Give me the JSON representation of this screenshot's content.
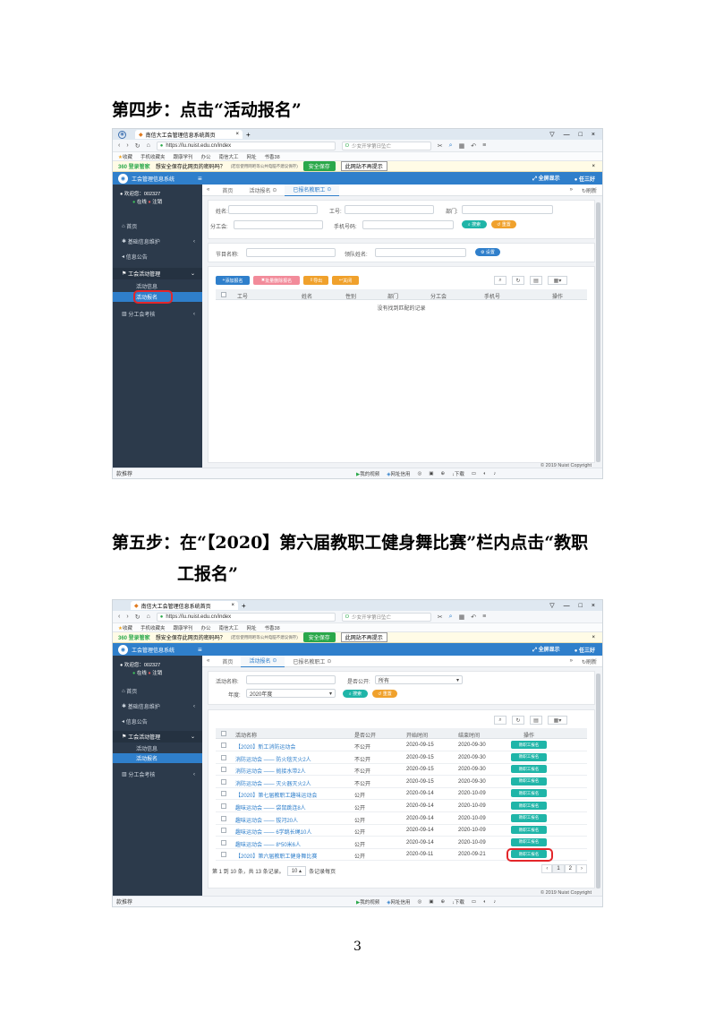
{
  "step4": {
    "heading": "第四步：点击“活动报名”"
  },
  "step5": {
    "heading_line1": "第五步：在“【2020】第六届教职工健身舞比赛”栏内点击“教职",
    "heading_line2": "工报名”"
  },
  "page_number": "3",
  "browser": {
    "tab_title": "南信大工会管理信息系统首页",
    "url": "https://lu.nuist.edu.cn/index",
    "search_placeholder": "少女开学第日坠亡",
    "favorites": [
      "收藏",
      "手机收藏夹",
      "跟康学刊",
      "办公",
      "南信大工",
      "网址",
      "书香38"
    ],
    "notice_brand": "360 登录管家",
    "notice_text": "想安全保存此网页的密码吗？",
    "notice_sub": "(若您使用网吧等公共电脑不建议保存)",
    "notice_save": "安全保存",
    "notice_dismiss": "此网站不再提示",
    "status_left": "款推荐",
    "status_items": [
      "我的视频",
      "网址信用",
      "下载"
    ]
  },
  "app": {
    "title": "工会管理信息系统",
    "menu_icon": "hamburger-icon",
    "fullscreen": "全屏显示",
    "user_name": "任三好",
    "welcome": "欢迎您：",
    "user_id": "002327",
    "online": "在线",
    "logout": "注销",
    "sidebar": {
      "home": "首页",
      "basic_info": "基础信息维护",
      "notice": "信息公告",
      "activity_mgmt": "工会活动管理",
      "activity_info": "活动信息",
      "activity_signup": "活动报名",
      "branch_eval": "分工会考核"
    },
    "refresh": "刷新",
    "copyright": "© 2019 Nuist Copyright"
  },
  "screen1": {
    "tabs": [
      "首页",
      "活动报名",
      "已报名教职工"
    ],
    "filters": {
      "name": "姓名:",
      "job_no": "工号:",
      "dept": "部门:",
      "branch": "分工会:",
      "phone": "手机号码:",
      "search": "搜索",
      "reset": "重置",
      "program": "节目名称:",
      "leader": "领队姓名:",
      "settings": "设置"
    },
    "toolbar": {
      "add": "添加报名",
      "batch_delete": "批量删除报名",
      "export": "导出",
      "close": "关闭"
    },
    "columns": [
      "工号",
      "姓名",
      "性别",
      "部门",
      "分工会",
      "手机号",
      "操作"
    ],
    "empty": "没有找到匹配的记录"
  },
  "screen2": {
    "tabs": [
      "首页",
      "活动报名",
      "已报名教职工"
    ],
    "filters": {
      "activity_name": "活动名称:",
      "is_public": "是否公开:",
      "is_public_value": "所有",
      "year": "年度:",
      "year_value": "2020年度",
      "search": "搜索",
      "reset": "重置"
    },
    "columns": [
      "活动名称",
      "是否公开",
      "开始时间",
      "结束时间",
      "操作"
    ],
    "rows": [
      {
        "name": "【2020】新工消防运动会",
        "public": "不公开",
        "start": "2020-09-15",
        "end": "2020-09-30",
        "action": "教职工报名"
      },
      {
        "name": "消防运动会 —— 防火毯灭火2人",
        "public": "不公开",
        "start": "2020-09-15",
        "end": "2020-09-30",
        "action": "教职工报名"
      },
      {
        "name": "消防运动会 —— 抛接水带2人",
        "public": "不公开",
        "start": "2020-09-15",
        "end": "2020-09-30",
        "action": "教职工报名"
      },
      {
        "name": "消防运动会 —— 灭火器灭火2人",
        "public": "不公开",
        "start": "2020-09-15",
        "end": "2020-09-30",
        "action": "教职工报名"
      },
      {
        "name": "【2020】第七届教职工趣味运动会",
        "public": "公开",
        "start": "2020-09-14",
        "end": "2020-10-09",
        "action": "教职工报名"
      },
      {
        "name": "趣味运动会 —— 袋鼠跳连8人",
        "public": "公开",
        "start": "2020-09-14",
        "end": "2020-10-09",
        "action": "教职工报名"
      },
      {
        "name": "趣味运动会 —— 拔河20人",
        "public": "公开",
        "start": "2020-09-14",
        "end": "2020-10-09",
        "action": "教职工报名"
      },
      {
        "name": "趣味运动会 —— 6学跳长绳10人",
        "public": "公开",
        "start": "2020-09-14",
        "end": "2020-10-09",
        "action": "教职工报名"
      },
      {
        "name": "趣味运动会 —— 8*50米6人",
        "public": "公开",
        "start": "2020-09-14",
        "end": "2020-10-09",
        "action": "教职工报名"
      },
      {
        "name": "【2020】第六届教职工健身舞比赛",
        "public": "公开",
        "start": "2020-09-11",
        "end": "2020-09-21",
        "action": "教职工报名"
      }
    ],
    "pagination_info": "第 1 到 10 条，共 13 条记录。",
    "page_size": "10",
    "page_size_suffix": "条记录每页",
    "pages": [
      "‹",
      "1",
      "2",
      "›"
    ]
  }
}
